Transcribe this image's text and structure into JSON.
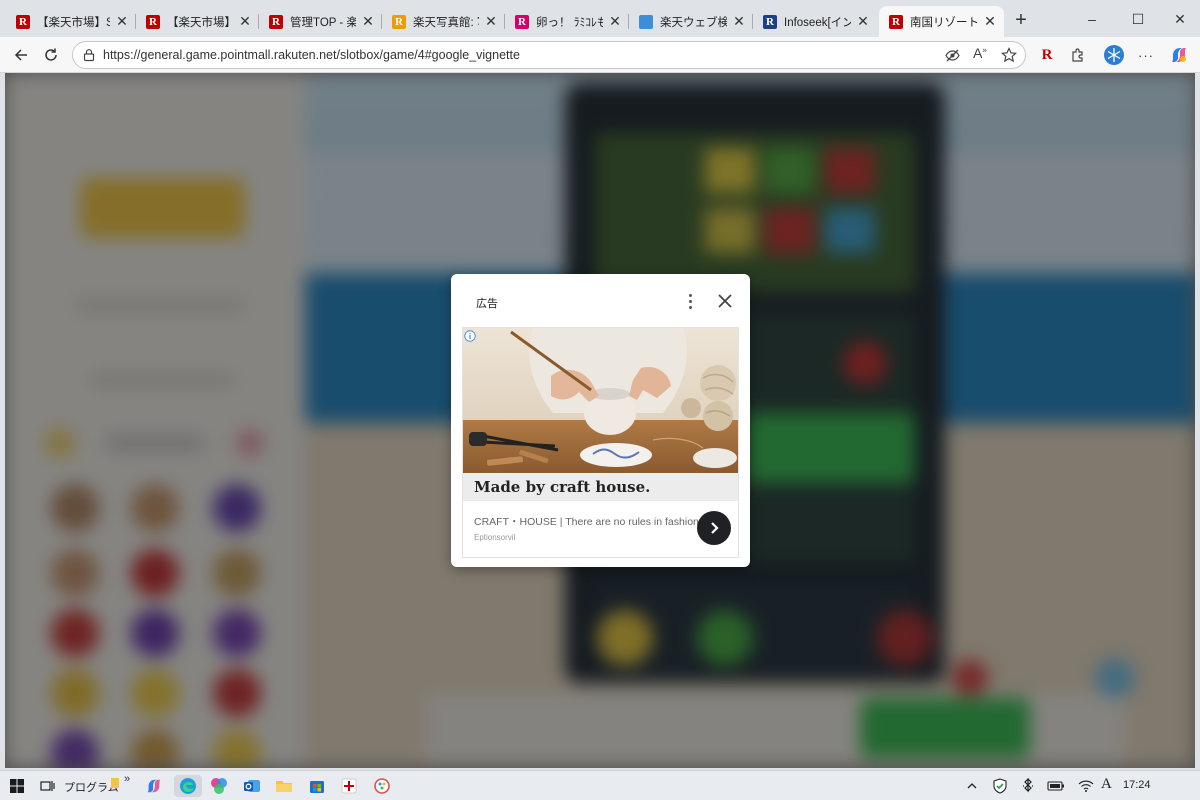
{
  "browser": {
    "tabs": [
      {
        "favicon_text": "R",
        "favicon_color": "#bf0000",
        "title": "【楽天市場】Shop"
      },
      {
        "favicon_text": "R",
        "favicon_color": "#bf0000",
        "title": "【楽天市場】ペー"
      },
      {
        "favicon_text": "R",
        "favicon_color": "#bf0000",
        "title": "管理TOP - 楽天"
      },
      {
        "favicon_text": "R",
        "favicon_color": "#f39a00",
        "title": "楽天写真館: 写"
      },
      {
        "favicon_text": "R",
        "favicon_color": "#d7006a",
        "title": "卵っ！ ﾗﾐｺﾚもﾗ"
      },
      {
        "favicon_text": "",
        "favicon_color": "#3a8fd8",
        "title": "楽天ウェブ検索"
      },
      {
        "favicon_text": "R",
        "favicon_color": "#1d3f8a",
        "title": "Infoseek[インフ"
      },
      {
        "favicon_text": "R",
        "favicon_color": "#bf0000",
        "title": "南国リゾートアニ"
      }
    ],
    "active_tab": 7,
    "new_tab_label": "+",
    "window_controls": {
      "minimize": "–",
      "maximize": "☐",
      "close": "✕"
    },
    "address": {
      "url": "https://general.game.pointmall.rakuten.net/slotbox/game/4#google_vignette"
    },
    "toolbar_icons": [
      "back-icon",
      "refresh-icon",
      "site-info-icon",
      "tracking-prevention-icon",
      "read-aloud-icon",
      "favorite-star-icon",
      "rakuten-extension-icon",
      "extensions-icon",
      "profile-icon",
      "more-icon",
      "copilot-icon"
    ],
    "more_label": "···"
  },
  "ad": {
    "label": "広告",
    "headline": "Made by craft house.",
    "body": "CRAFT・HOUSE | There are no rules in fashion",
    "source": "Eptionsorvil",
    "info_icon": "info-icon",
    "cta_icon": "chevron-right-icon"
  },
  "taskbar": {
    "program_label": "プログラム",
    "overflow_label": "»",
    "ime_label": "A",
    "time": "17:24",
    "tray_icons": [
      "chevron-up-icon",
      "security-icon",
      "bluetooth-icon",
      "battery-icon",
      "wifi-icon"
    ],
    "app_icons": [
      "start-icon",
      "task-view-icon",
      "copilot-icon",
      "edge-icon",
      "color-app-icon",
      "outlook-icon",
      "file-explorer-icon",
      "store-icon",
      "rakuten-icon",
      "paint-icon"
    ]
  },
  "colors": {
    "accent_red": "#bf0000",
    "taskbar_bg": "#e8ebf0",
    "dialog_bg": "#ffffff"
  }
}
